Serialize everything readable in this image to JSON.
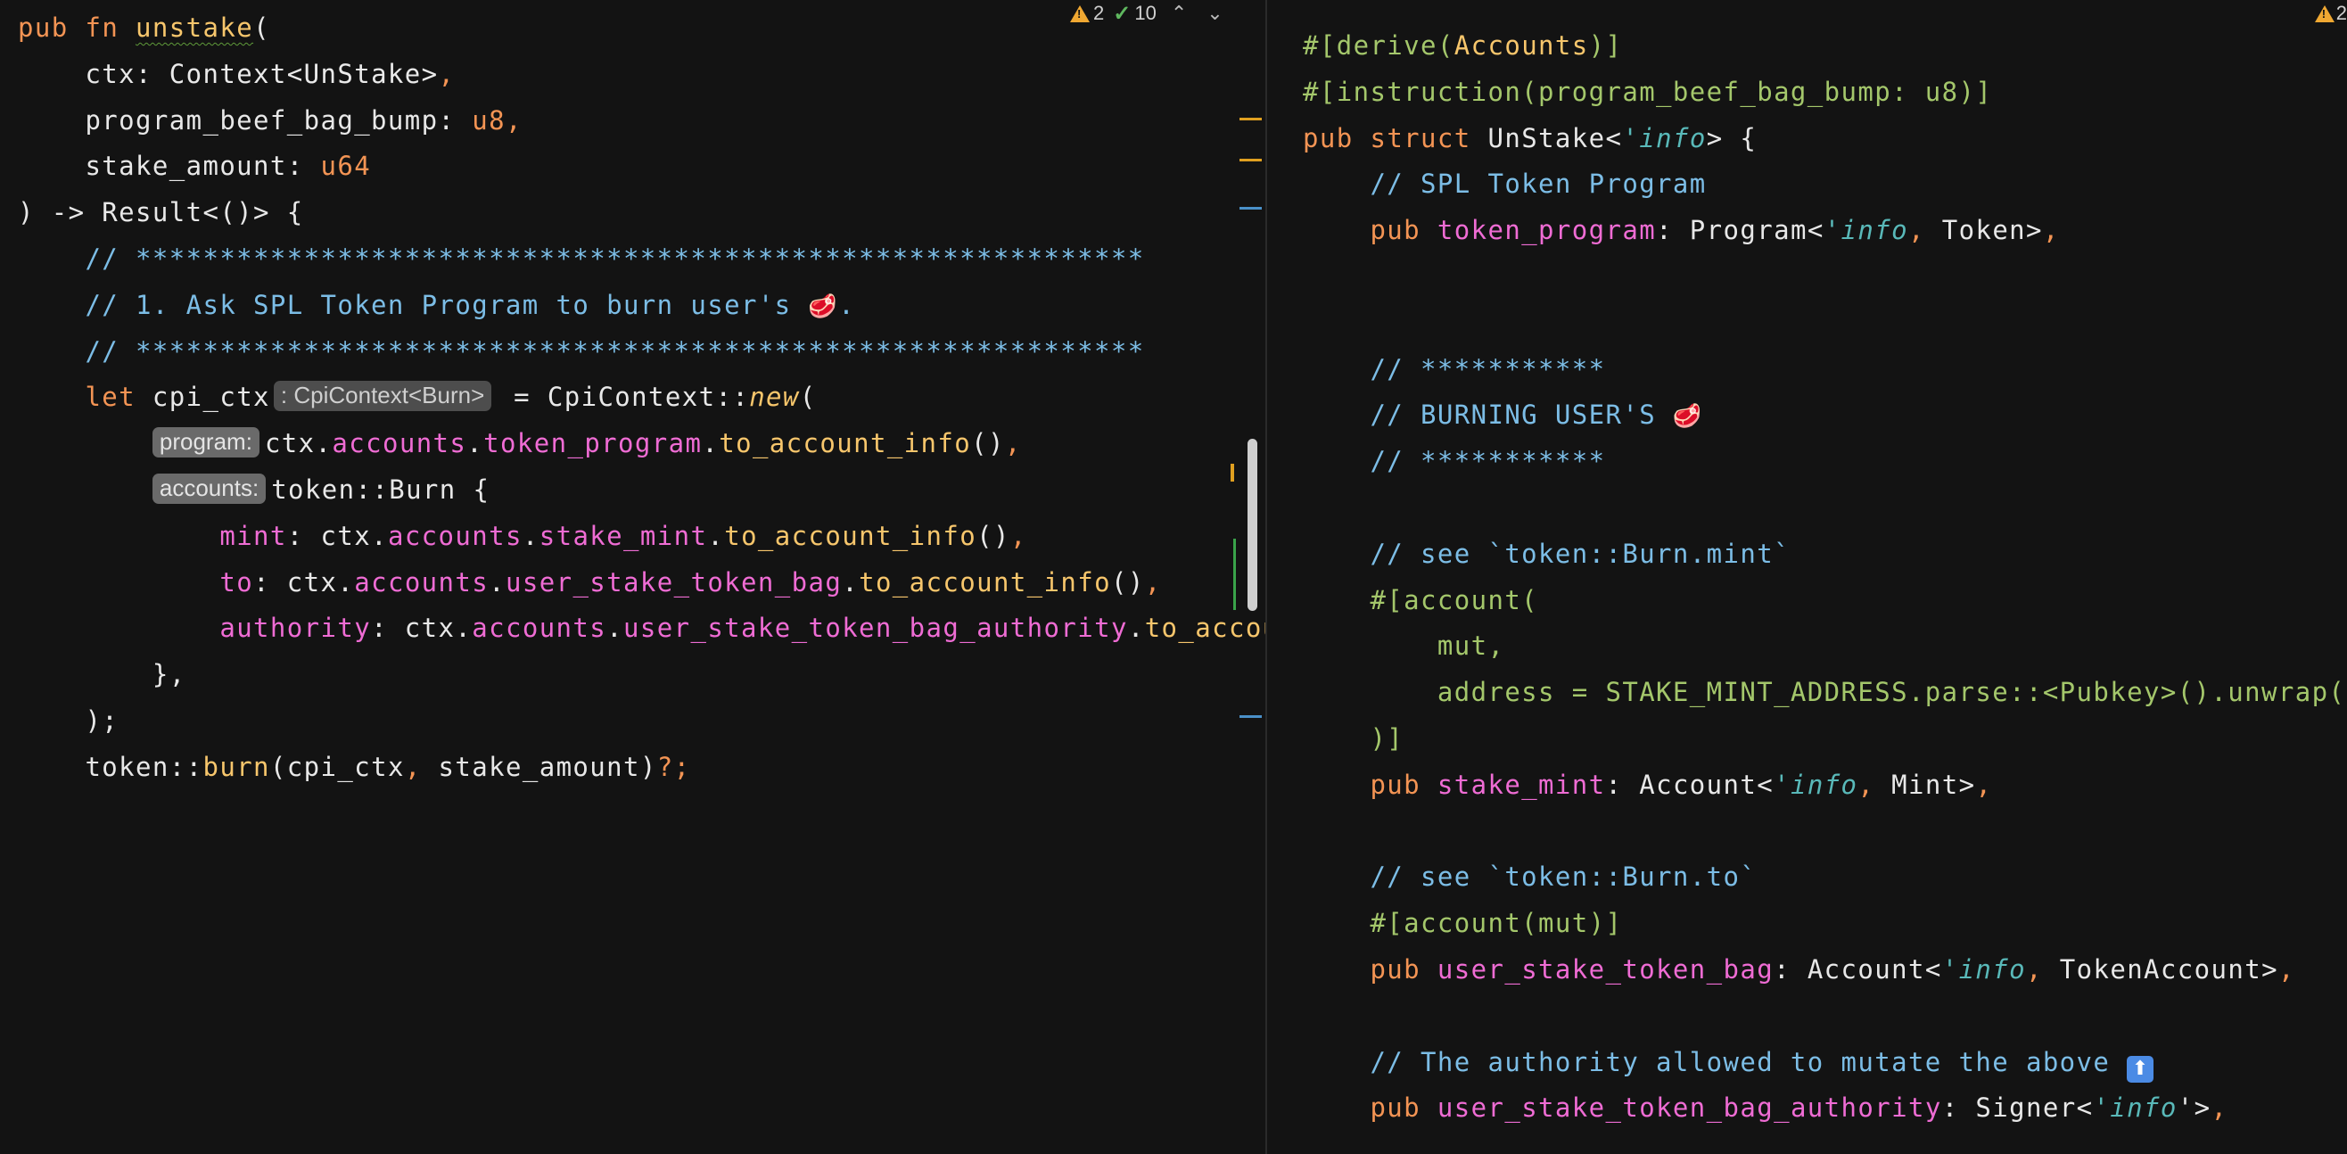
{
  "left_editor": {
    "inspections": {
      "warnings": "2",
      "checks": "10"
    },
    "lines": [
      [
        [
          "kw",
          "pub "
        ],
        [
          "kw",
          "fn "
        ],
        [
          "fnu",
          "unstake"
        ],
        [
          "",
          "("
        ]
      ],
      [
        [
          "",
          "    ctx: "
        ],
        [
          "ty",
          "Context<UnStake>"
        ],
        [
          "pn",
          ","
        ]
      ],
      [
        [
          "",
          "    program_beef_bag_bump: "
        ],
        [
          "num",
          "u8"
        ],
        [
          "pn",
          ","
        ]
      ],
      [
        [
          "",
          "    stake_amount: "
        ],
        [
          "num",
          "u64"
        ]
      ],
      [
        [
          "",
          ") -> Result<()> {"
        ]
      ],
      [
        [
          "cm",
          "    // ************************************************************"
        ]
      ],
      [
        [
          "cm",
          "    // 1. Ask SPL Token Program to burn user's "
        ],
        [
          "emo",
          "🥩"
        ],
        [
          "cm",
          "."
        ]
      ],
      [
        [
          "cm",
          "    // ************************************************************"
        ]
      ],
      [
        [
          "kw",
          "    let "
        ],
        [
          "",
          "cpi_ctx"
        ],
        [
          "hint type-hint",
          ": CpiContext<Burn>"
        ],
        [
          "",
          " = CpiContext::"
        ],
        [
          "it",
          "new"
        ],
        [
          "",
          "("
        ]
      ],
      [
        [
          "",
          "        "
        ],
        [
          "hint",
          "program:"
        ],
        [
          "",
          "ctx."
        ],
        [
          "fld",
          "accounts"
        ],
        [
          "",
          "."
        ],
        [
          "fld",
          "token_program"
        ],
        [
          "",
          "."
        ],
        [
          "mth",
          "to_account_info"
        ],
        [
          "",
          "()"
        ],
        [
          "pn",
          ","
        ]
      ],
      [
        [
          "",
          "        "
        ],
        [
          "hint",
          "accounts:"
        ],
        [
          "",
          "token::Burn {"
        ]
      ],
      [
        [
          "",
          "            "
        ],
        [
          "fld",
          "mint"
        ],
        [
          "",
          ": ctx."
        ],
        [
          "fld",
          "accounts"
        ],
        [
          "",
          "."
        ],
        [
          "fld",
          "stake_mint"
        ],
        [
          "",
          "."
        ],
        [
          "mth",
          "to_account_info"
        ],
        [
          "",
          "()"
        ],
        [
          "pn",
          ","
        ]
      ],
      [
        [
          "",
          "            "
        ],
        [
          "fld",
          "to"
        ],
        [
          "",
          ": ctx."
        ],
        [
          "fld",
          "accounts"
        ],
        [
          "",
          "."
        ],
        [
          "fld",
          "user_stake_token_bag"
        ],
        [
          "",
          "."
        ],
        [
          "mth",
          "to_account_info"
        ],
        [
          "",
          "()"
        ],
        [
          "pn",
          ","
        ]
      ],
      [
        [
          "",
          "            "
        ],
        [
          "fld",
          "authority"
        ],
        [
          "",
          ": ctx."
        ],
        [
          "fld",
          "accounts"
        ],
        [
          "",
          "."
        ],
        [
          "fld",
          "user_stake_token_bag_authority"
        ],
        [
          "",
          "."
        ],
        [
          "mth",
          "to_account_info"
        ],
        [
          "",
          "()"
        ],
        [
          "pn",
          ","
        ]
      ],
      [
        [
          "",
          "        },"
        ]
      ],
      [
        [
          "",
          "    );"
        ]
      ],
      [
        [
          "",
          "    token::"
        ],
        [
          "mth",
          "burn"
        ],
        [
          "",
          "(cpi_ctx"
        ],
        [
          "pn",
          ", "
        ],
        [
          "",
          "stake_amount)"
        ],
        [
          "pn",
          "?;"
        ]
      ]
    ]
  },
  "right_editor": {
    "inspections": {
      "warnings": "2"
    },
    "lines": [
      [
        [
          "at",
          "#[derive("
        ],
        [
          "dc",
          "Accounts"
        ],
        [
          "at",
          ")]"
        ]
      ],
      [
        [
          "at",
          "#[instruction(program_beef_bag_bump: u8)]"
        ]
      ],
      [
        [
          "kw",
          "pub "
        ],
        [
          "kw",
          "struct "
        ],
        [
          "",
          "UnStake<"
        ],
        [
          "lt",
          "'info"
        ],
        [
          "",
          "> {"
        ]
      ],
      [
        [
          "cm",
          "    // SPL Token Program"
        ]
      ],
      [
        [
          "kw",
          "    pub "
        ],
        [
          "fld",
          "token_program"
        ],
        [
          "",
          ": Program<"
        ],
        [
          "lt",
          "'info"
        ],
        [
          "pn",
          ", "
        ],
        [
          "",
          "Token>"
        ],
        [
          "pn",
          ","
        ]
      ],
      [
        [
          "",
          ""
        ]
      ],
      [
        [
          "",
          ""
        ]
      ],
      [
        [
          "cm",
          "    // ***********"
        ]
      ],
      [
        [
          "cm",
          "    // BURNING USER'S "
        ],
        [
          "emo",
          "🥩"
        ]
      ],
      [
        [
          "cm",
          "    // ***********"
        ]
      ],
      [
        [
          "",
          ""
        ]
      ],
      [
        [
          "cm",
          "    // see `token::Burn.mint`"
        ]
      ],
      [
        [
          "at",
          "    #[account("
        ]
      ],
      [
        [
          "at",
          "        mut,"
        ]
      ],
      [
        [
          "at",
          "        address = STAKE_MINT_ADDRESS.parse::<Pubkey>().unwrap(),"
        ]
      ],
      [
        [
          "at",
          "    )]"
        ]
      ],
      [
        [
          "kw",
          "    pub "
        ],
        [
          "fld",
          "stake_mint"
        ],
        [
          "",
          ": Account<"
        ],
        [
          "lt",
          "'info"
        ],
        [
          "pn",
          ", "
        ],
        [
          "",
          "Mint>"
        ],
        [
          "pn",
          ","
        ]
      ],
      [
        [
          "",
          ""
        ]
      ],
      [
        [
          "cm",
          "    // see `token::Burn.to`"
        ]
      ],
      [
        [
          "at",
          "    #[account(mut)]"
        ]
      ],
      [
        [
          "kw",
          "    pub "
        ],
        [
          "fld",
          "user_stake_token_bag"
        ],
        [
          "",
          ": Account<"
        ],
        [
          "lt",
          "'info"
        ],
        [
          "pn",
          ", "
        ],
        [
          "",
          "TokenAccount>"
        ],
        [
          "pn",
          ","
        ]
      ],
      [
        [
          "",
          ""
        ]
      ],
      [
        [
          "cm",
          "    // The authority allowed to mutate the above "
        ],
        [
          "emo-up",
          "⬆"
        ]
      ],
      [
        [
          "kw",
          "    pub "
        ],
        [
          "fld",
          "user_stake_token_bag_authority"
        ],
        [
          "",
          ": Signer<"
        ],
        [
          "lt",
          "'info"
        ],
        [
          "",
          "'>"
        ],
        [
          "pn",
          ","
        ]
      ]
    ]
  },
  "colors": {
    "background": "#131313",
    "keyword": "#f39454",
    "comment": "#7cbde6",
    "attribute": "#a4c76b",
    "field": "#ef6cd4",
    "method": "#f7c66c",
    "lifetime": "#59b9b9"
  }
}
